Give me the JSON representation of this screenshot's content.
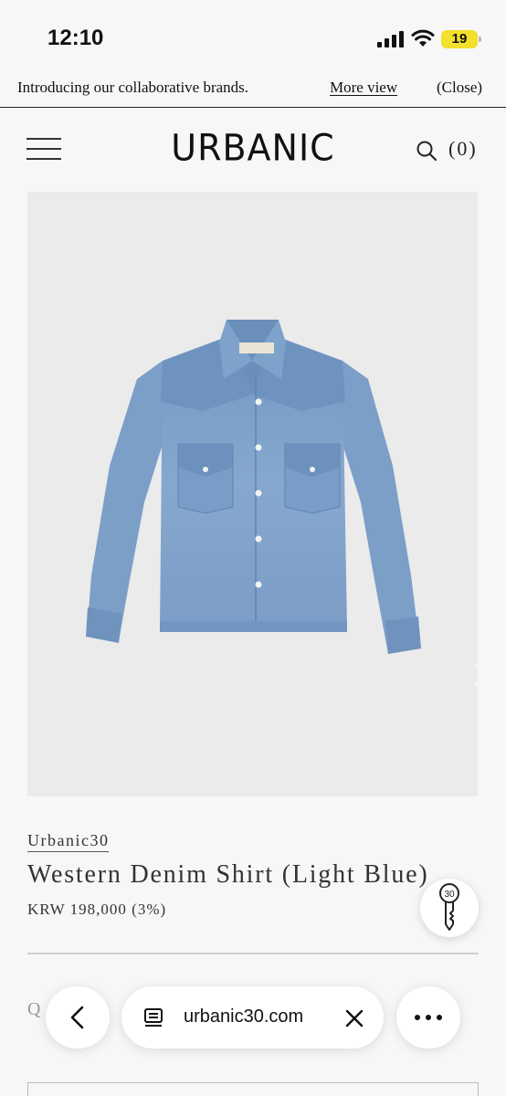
{
  "status_bar": {
    "time": "12:10",
    "battery": "19"
  },
  "announcement": {
    "message": "Introducing our collaborative brands.",
    "more_label": "More view",
    "close_label": "(Close)"
  },
  "header": {
    "logo": "URBANIC",
    "cart_count": "(0)"
  },
  "product": {
    "brand": "Urbanic30",
    "title": "Western Denim Shirt (Light Blue)",
    "price": "KRW 198,000 (3%)",
    "quantity_label": "Q"
  },
  "floating_button": {
    "label": "30"
  },
  "browser": {
    "url": "urbanic30.com"
  },
  "colors": {
    "background": "#f7f7f7",
    "image_background": "#ebebec",
    "denim": "#7fa2c8",
    "battery": "#f2e02a"
  },
  "icons": [
    "menu-icon",
    "search-icon",
    "chevron-right-icon",
    "key-icon",
    "back-arrow-icon",
    "tabs-icon",
    "close-icon",
    "more-icon",
    "signal-icon",
    "wifi-icon"
  ]
}
